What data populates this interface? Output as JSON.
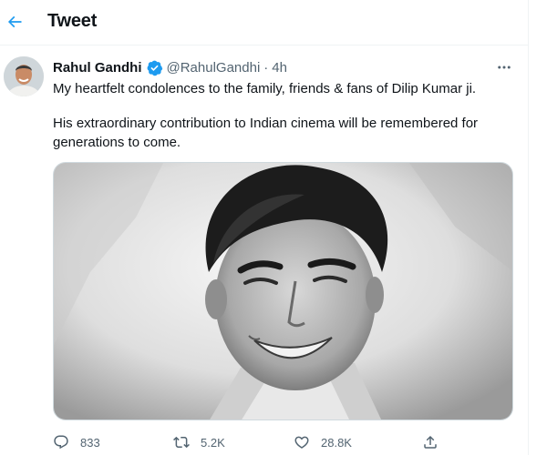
{
  "header": {
    "title": "Tweet",
    "back_icon": "arrow-left-icon",
    "accent": "#1d9bf0"
  },
  "tweet": {
    "author": {
      "display_name": "Rahul Gandhi",
      "handle": "@RahulGandhi",
      "verified": true
    },
    "separator": "·",
    "time": "4h",
    "paragraphs": [
      "My heartfelt condolences to the family, friends & fans of Dilip Kumar ji.",
      "His extraordinary contribution to Indian cinema will be remembered for generations to come."
    ],
    "actions": {
      "reply_count": "833",
      "retweet_count": "5.2K",
      "like_count": "28.8K"
    }
  },
  "colors": {
    "text": "#0f1419",
    "secondary": "#536471",
    "accent": "#1d9bf0",
    "border": "#eff3f4"
  }
}
